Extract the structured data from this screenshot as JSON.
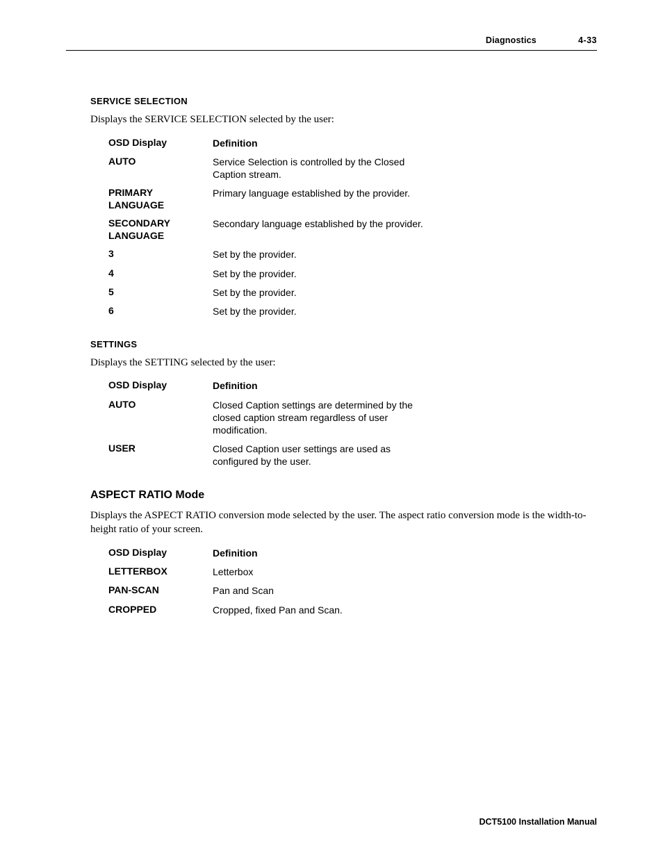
{
  "header": {
    "chapter": "Diagnostics",
    "page_number": "4-33"
  },
  "service_selection": {
    "label": "SERVICE SELECTION",
    "intro": "Displays the SERVICE SELECTION selected by the user:",
    "head": {
      "c1": "OSD Display",
      "c2": "Definition"
    },
    "rows": [
      {
        "c1": "AUTO",
        "c2": "Service Selection is controlled by the Closed Caption stream."
      },
      {
        "c1": "PRIMARY LANGUAGE",
        "c2": "Primary language established by the provider."
      },
      {
        "c1": "SECONDARY LANGUAGE",
        "c2": "Secondary language established by the provider."
      },
      {
        "c1": "3",
        "c2": "Set by the provider."
      },
      {
        "c1": "4",
        "c2": "Set by the provider."
      },
      {
        "c1": "5",
        "c2": "Set by the provider."
      },
      {
        "c1": "6",
        "c2": "Set by the provider."
      }
    ]
  },
  "settings": {
    "label": "SETTINGS",
    "intro": "Displays the SETTING selected by the user:",
    "head": {
      "c1": "OSD Display",
      "c2": "Definition"
    },
    "rows": [
      {
        "c1": "AUTO",
        "c2": "Closed Caption settings are determined by the closed caption stream regardless of user modification."
      },
      {
        "c1": "USER",
        "c2": "Closed Caption user settings are used as configured by the user."
      }
    ]
  },
  "aspect_ratio": {
    "title": "ASPECT RATIO Mode",
    "intro": "Displays the ASPECT RATIO conversion mode selected by the user. The aspect ratio conversion mode is the width-to-height ratio of your screen.",
    "head": {
      "c1": "OSD Display",
      "c2": "Definition"
    },
    "rows": [
      {
        "c1": "LETTERBOX",
        "c2": "Letterbox"
      },
      {
        "c1": "PAN-SCAN",
        "c2": "Pan and Scan"
      },
      {
        "c1": "CROPPED",
        "c2": "Cropped, fixed Pan and Scan."
      }
    ]
  },
  "footer": {
    "manual": "DCT5100 Installation Manual"
  }
}
